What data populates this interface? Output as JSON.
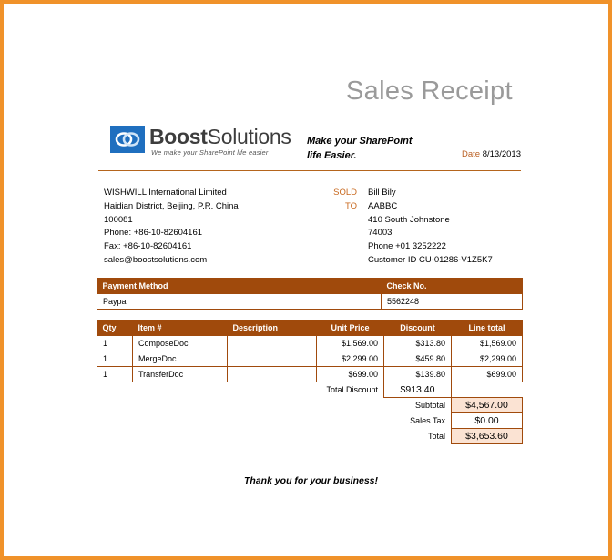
{
  "title": "Sales Receipt",
  "brand": {
    "name_bold": "Boost",
    "name_rest": "Solutions",
    "tagline": "We make your SharePoint life easier"
  },
  "slogan": {
    "line1": "Make your SharePoint",
    "line2": "life Easier."
  },
  "date": {
    "label": "Date",
    "value": "8/13/2013"
  },
  "seller": {
    "company": "WISHWILL International Limited",
    "address1": "Haidian District, Beijing, P.R. China",
    "postal": "100081",
    "phone": "Phone: +86-10-82604161",
    "fax": "Fax: +86-10-82604161",
    "email": "sales@boostsolutions.com"
  },
  "sold_to": {
    "label1": "SOLD",
    "label2": "TO"
  },
  "customer": {
    "name": "Bill Bily",
    "company": "AABBC",
    "street": "410 South Johnstone",
    "zip": "74003",
    "phone": "Phone +01 3252222",
    "id": "Customer ID CU-01286-V1Z5K7"
  },
  "payment": {
    "headers": [
      "Payment Method",
      "Check No."
    ],
    "method": "Paypal",
    "check_no": "5562248"
  },
  "items": {
    "headers": [
      "Qty",
      "Item #",
      "Description",
      "Unit Price",
      "Discount",
      "Line total"
    ],
    "rows": [
      {
        "qty": "1",
        "item": "ComposeDoc",
        "desc": "",
        "unit": "$1,569.00",
        "disc": "$313.80",
        "total": "$1,569.00"
      },
      {
        "qty": "1",
        "item": "MergeDoc",
        "desc": "",
        "unit": "$2,299.00",
        "disc": "$459.80",
        "total": "$2,299.00"
      },
      {
        "qty": "1",
        "item": "TransferDoc",
        "desc": "",
        "unit": "$699.00",
        "disc": "$139.80",
        "total": "$699.00"
      }
    ]
  },
  "totals": {
    "discount_label": "Total Discount",
    "discount_value": "$913.40",
    "subtotal_label": "Subtotal",
    "subtotal_value": "$4,567.00",
    "tax_label": "Sales Tax",
    "tax_value": "$0.00",
    "total_label": "Total",
    "total_value": "$3,653.60"
  },
  "thanks": "Thank you for your business!",
  "colors": {
    "accent": "#a04a0c",
    "frame": "#f0922a",
    "highlight": "#fbe3d3",
    "logo_blue": "#1f6fbf"
  }
}
